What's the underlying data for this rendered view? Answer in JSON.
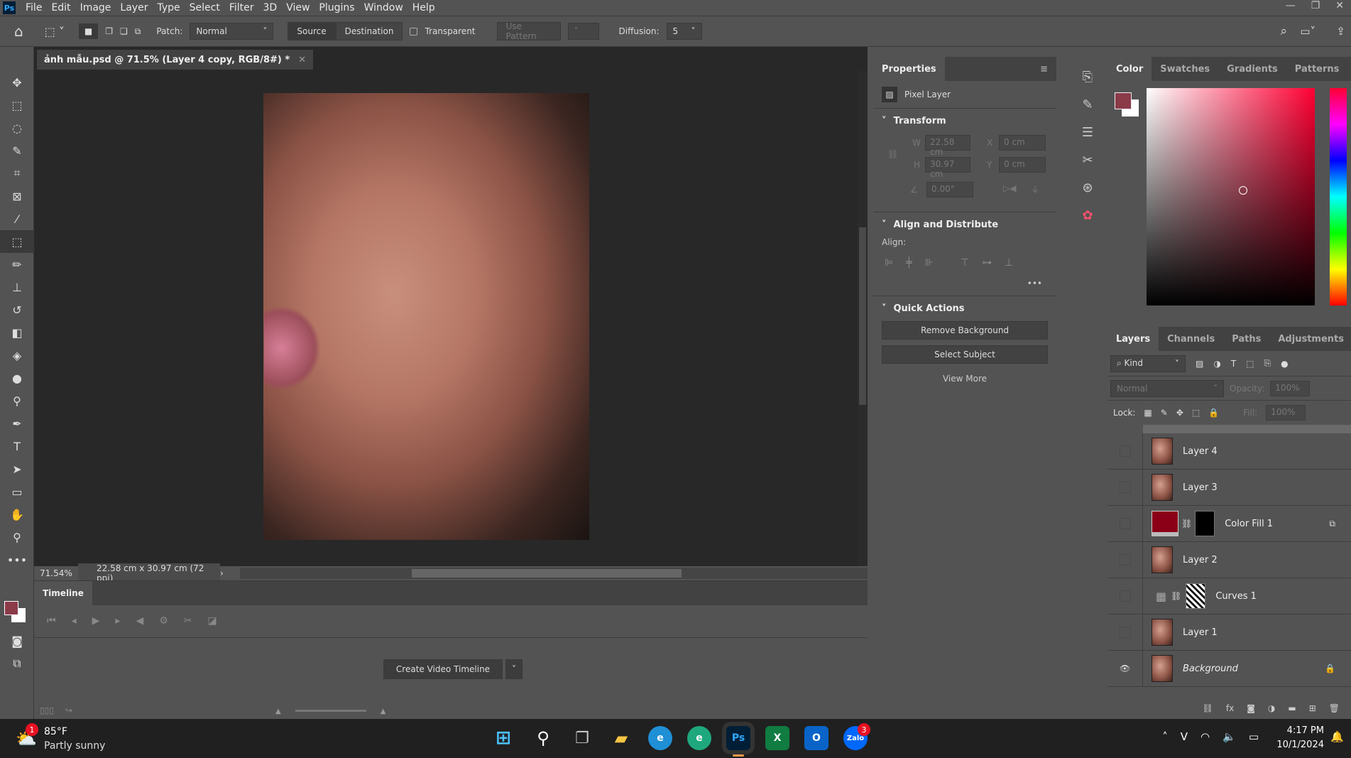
{
  "menu": {
    "logo": "Ps",
    "items": [
      "File",
      "Edit",
      "Image",
      "Layer",
      "Type",
      "Select",
      "Filter",
      "3D",
      "View",
      "Plugins",
      "Window",
      "Help"
    ]
  },
  "options": {
    "patch_label": "Patch:",
    "patch_mode": "Normal",
    "source": "Source",
    "destination": "Destination",
    "transparent": "Transparent",
    "use_pattern": "Use Pattern",
    "diffusion_label": "Diffusion:",
    "diffusion_value": "5"
  },
  "document": {
    "tab_title": "ảnh mẫu.psd @ 71.5% (Layer 4 copy, RGB/8#) *",
    "zoom": "71.54%",
    "doc_info": "22.58 cm x 30.97 cm (72 ppi)"
  },
  "timeline": {
    "title": "Timeline",
    "create_button": "Create Video Timeline"
  },
  "properties": {
    "title": "Properties",
    "layer_type": "Pixel Layer",
    "transform": "Transform",
    "w_label": "W",
    "w": "22.58 cm",
    "h_label": "H",
    "h": "30.97 cm",
    "x_label": "X",
    "x": "0 cm",
    "y_label": "Y",
    "y": "0 cm",
    "angle": "0.00°",
    "align_distribute": "Align and Distribute",
    "align_label": "Align:",
    "quick_actions": "Quick Actions",
    "remove_bg": "Remove Background",
    "select_subject": "Select Subject",
    "view_more": "View More"
  },
  "color_panel": {
    "tabs": [
      "Color",
      "Swatches",
      "Gradients",
      "Patterns"
    ],
    "foreground": "#8b3a48",
    "background": "#ffffff",
    "hue": "#ff0033"
  },
  "layers_panel": {
    "tabs": [
      "Layers",
      "Channels",
      "Paths",
      "Adjustments"
    ],
    "filter": "Kind",
    "blend": "Normal",
    "opacity_label": "Opacity:",
    "opacity": "100%",
    "lock_label": "Lock:",
    "fill_label": "Fill:",
    "fill": "100%",
    "layers": [
      {
        "name": "Layer 4",
        "type": "pixel",
        "visible": false
      },
      {
        "name": "Layer 3",
        "type": "pixel",
        "visible": false
      },
      {
        "name": "Color Fill 1",
        "type": "fill",
        "visible": false,
        "color": "#8b0016"
      },
      {
        "name": "Layer 2",
        "type": "pixel",
        "visible": false
      },
      {
        "name": "Curves 1",
        "type": "curves",
        "visible": false
      },
      {
        "name": "Layer 1",
        "type": "pixel",
        "visible": false
      },
      {
        "name": "Background",
        "type": "pixel",
        "visible": true,
        "locked": true
      }
    ]
  },
  "taskbar": {
    "temperature": "85°F",
    "weather": "Partly sunny",
    "weather_badge": "1",
    "time": "4:17 PM",
    "date": "10/1/2024",
    "zalo_badge": "3",
    "zalo": "Zalo",
    "ps": "Ps",
    "excel": "X",
    "outlook": "O"
  }
}
